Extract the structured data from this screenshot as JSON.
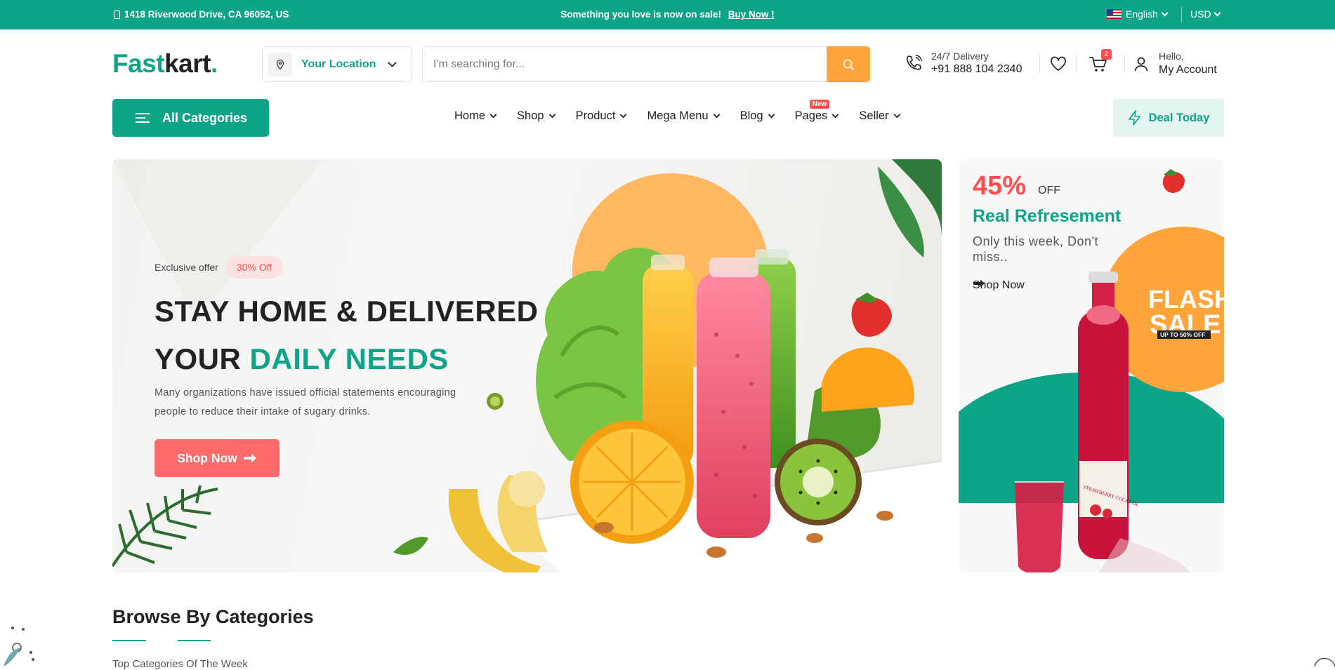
{
  "topbar": {
    "address": "1418 Riverwood Drive, CA 96052, US",
    "promo_text": "Something you love is now on sale!",
    "promo_link": "Buy Now !",
    "language": "English",
    "currency": "USD"
  },
  "header": {
    "logo_part1": "Fast",
    "logo_part2": "kart",
    "logo_dot": ".",
    "location_label": "Your Location",
    "search_placeholder": "I'm searching for...",
    "delivery_label": "24/7 Delivery",
    "delivery_phone": "+91 888 104 2340",
    "cart_count": "2",
    "account_greeting": "Hello,",
    "account_label": "My Account"
  },
  "nav": {
    "all_categories": "All Categories",
    "items": [
      {
        "label": "Home"
      },
      {
        "label": "Shop"
      },
      {
        "label": "Product"
      },
      {
        "label": "Mega Menu"
      },
      {
        "label": "Blog"
      },
      {
        "label": "Pages",
        "badge": "New"
      },
      {
        "label": "Seller"
      }
    ],
    "deal_today": "Deal Today"
  },
  "hero": {
    "tag": "Exclusive offer",
    "off_badge": "30% Off",
    "headline_line1": "STAY HOME & DELIVERED",
    "headline_line2_plain": "YOUR",
    "headline_line2_accent": "DAILY NEEDS",
    "description": "Many organizations have issued official statements encouraging people to reduce their intake of sugary drinks.",
    "button": "Shop Now"
  },
  "side_banner": {
    "percent": "45%",
    "off": "OFF",
    "title": "Real Refresement",
    "subtitle": "Only this week, Don't miss..",
    "link": "Shop Now",
    "flash_line1": "FLASH",
    "flash_line2": "SALE",
    "flash_note": "UP TO 50% OFF",
    "bottle_label": "STRAWBERRY COCKTAIL"
  },
  "browse": {
    "title": "Browse By Categories",
    "subtitle": "Top Categories Of The Week"
  },
  "colors": {
    "brand": "#0da487",
    "accent_orange": "#ffa53b",
    "accent_red": "#ff4f4f"
  }
}
